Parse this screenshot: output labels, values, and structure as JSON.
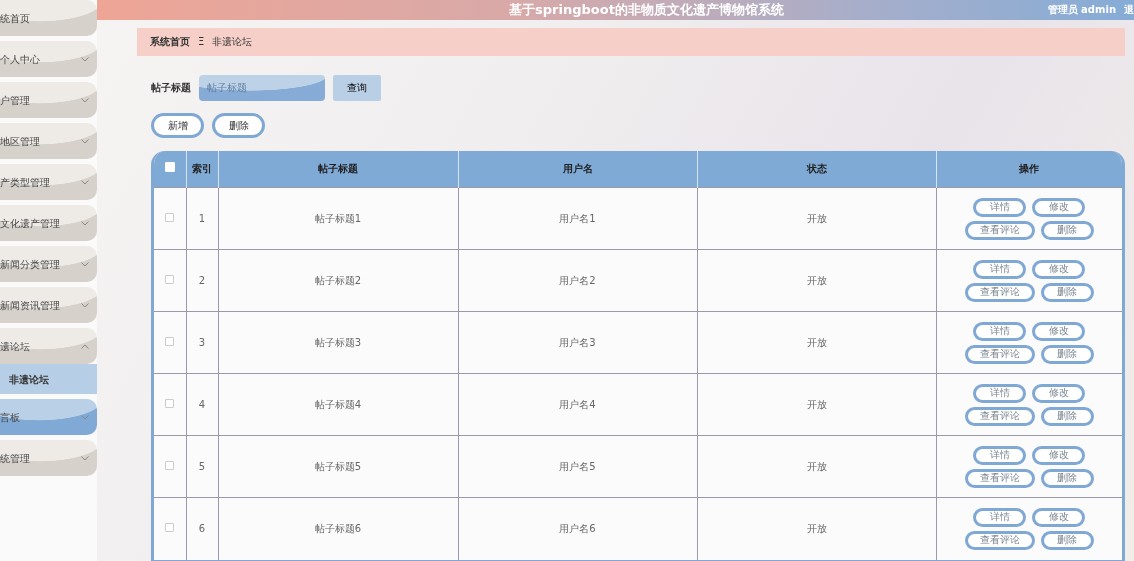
{
  "header": {
    "title": "基于springboot的非物质文化遗产博物馆系统",
    "user": "管理员 admin",
    "logout": "退"
  },
  "sidebar": {
    "items": [
      {
        "label": "统首页",
        "hovered": false,
        "has_caret": false
      },
      {
        "label": "个人中心",
        "expanded": false,
        "hovered": false,
        "has_caret": true
      },
      {
        "label": "户管理",
        "expanded": false,
        "hovered": false,
        "has_caret": true
      },
      {
        "label": "地区管理",
        "expanded": false,
        "hovered": false,
        "has_caret": true
      },
      {
        "label": "产类型管理",
        "expanded": false,
        "hovered": false,
        "has_caret": true
      },
      {
        "label": "文化遗产管理",
        "expanded": false,
        "hovered": false,
        "has_caret": true
      },
      {
        "label": "新闻分类管理",
        "expanded": false,
        "hovered": false,
        "has_caret": true
      },
      {
        "label": "新闻资讯管理",
        "expanded": false,
        "hovered": false,
        "has_caret": true
      },
      {
        "label": "遗论坛",
        "expanded": true,
        "hovered": false,
        "has_caret": true,
        "children": [
          {
            "label": "非遗论坛",
            "selected": true
          }
        ]
      },
      {
        "label": "言板",
        "expanded": false,
        "hovered": true,
        "has_caret": true
      },
      {
        "label": "统管理",
        "expanded": false,
        "hovered": false,
        "has_caret": true
      }
    ]
  },
  "breadcrumb": {
    "items": [
      "系统首页",
      "非遗论坛"
    ],
    "separator": "Ξ"
  },
  "search": {
    "label": "帖子标题",
    "placeholder": "帖子标题",
    "button": "查询"
  },
  "actions": [
    "新增",
    "删除"
  ],
  "table": {
    "columns": [
      "索引",
      "帖子标题",
      "用户名",
      "状态",
      "操作"
    ],
    "all_checked": false,
    "rows": [
      {
        "checked": false,
        "index": "1",
        "title": "帖子标题1",
        "user": "用户名1",
        "status": "开放",
        "buttons": [
          "详情",
          "修改",
          "查看评论",
          "删除"
        ]
      },
      {
        "checked": false,
        "index": "2",
        "title": "帖子标题2",
        "user": "用户名2",
        "status": "开放",
        "buttons": [
          "详情",
          "修改",
          "查看评论",
          "删除"
        ]
      },
      {
        "checked": false,
        "index": "3",
        "title": "帖子标题3",
        "user": "用户名3",
        "status": "开放",
        "buttons": [
          "详情",
          "修改",
          "查看评论",
          "删除"
        ]
      },
      {
        "checked": false,
        "index": "4",
        "title": "帖子标题4",
        "user": "用户名4",
        "status": "开放",
        "buttons": [
          "详情",
          "修改",
          "查看评论",
          "删除"
        ]
      },
      {
        "checked": false,
        "index": "5",
        "title": "帖子标题5",
        "user": "用户名5",
        "status": "开放",
        "buttons": [
          "详情",
          "修改",
          "查看评论",
          "删除"
        ]
      },
      {
        "checked": false,
        "index": "6",
        "title": "帖子标题6",
        "user": "用户名6",
        "status": "开放",
        "buttons": [
          "详情",
          "修改",
          "查看评论",
          "删除"
        ]
      }
    ]
  }
}
